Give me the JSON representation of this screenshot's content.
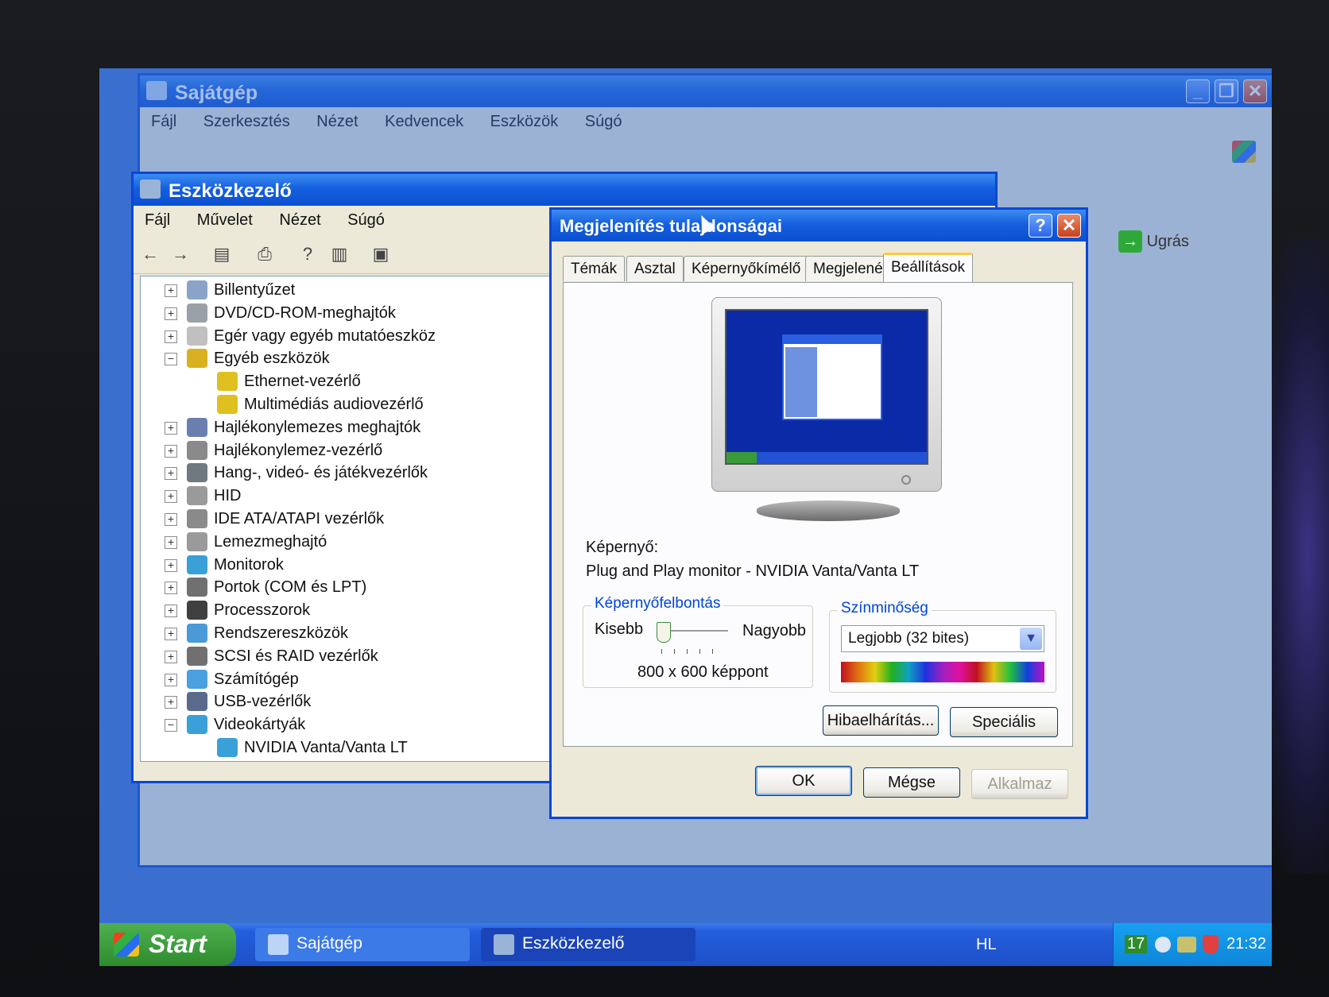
{
  "sajatgep": {
    "title": "Sajátgép",
    "menu": [
      "Fájl",
      "Szerkesztés",
      "Nézet",
      "Kedvencek",
      "Eszközök",
      "Súgó"
    ],
    "go_label": "Ugrás"
  },
  "devmgr": {
    "title": "Eszközkezelő",
    "menu": [
      "Fájl",
      "Művelet",
      "Nézet",
      "Súgó"
    ],
    "tree": [
      {
        "label": "Billentyűzet",
        "state": "+",
        "icon": "keyboard-icon"
      },
      {
        "label": "DVD/CD-ROM-meghajtók",
        "state": "+",
        "icon": "cdrom-icon"
      },
      {
        "label": "Egér vagy egyéb mutatóeszköz",
        "state": "+",
        "icon": "mouse-icon"
      },
      {
        "label": "Egyéb eszközök",
        "state": "-",
        "icon": "unknown-device-icon"
      },
      {
        "label": "Ethernet-vezérlő",
        "state": "child",
        "icon": "warning-device-icon"
      },
      {
        "label": "Multimédiás audiovezérlő",
        "state": "child",
        "icon": "warning-device-icon"
      },
      {
        "label": "Hajlékonylemezes meghajtók",
        "state": "+",
        "icon": "floppy-drive-icon"
      },
      {
        "label": "Hajlékonylemez-vezérlő",
        "state": "+",
        "icon": "floppy-controller-icon"
      },
      {
        "label": "Hang-, videó- és játékvezérlők",
        "state": "+",
        "icon": "sound-icon"
      },
      {
        "label": "HID",
        "state": "+",
        "icon": "hid-icon"
      },
      {
        "label": "IDE ATA/ATAPI vezérlők",
        "state": "+",
        "icon": "ide-icon"
      },
      {
        "label": "Lemezmeghajtó",
        "state": "+",
        "icon": "disk-icon"
      },
      {
        "label": "Monitorok",
        "state": "+",
        "icon": "monitor-icon"
      },
      {
        "label": "Portok (COM és LPT)",
        "state": "+",
        "icon": "port-icon"
      },
      {
        "label": "Processzorok",
        "state": "+",
        "icon": "cpu-icon"
      },
      {
        "label": "Rendszereszközök",
        "state": "+",
        "icon": "system-icon"
      },
      {
        "label": "SCSI és RAID vezérlők",
        "state": "+",
        "icon": "scsi-icon"
      },
      {
        "label": "Számítógép",
        "state": "+",
        "icon": "computer-icon"
      },
      {
        "label": "USB-vezérlők",
        "state": "+",
        "icon": "usb-icon"
      },
      {
        "label": "Videokártyák",
        "state": "-",
        "icon": "display-adapter-icon"
      },
      {
        "label": "NVIDIA Vanta/Vanta LT",
        "state": "child",
        "icon": "display-adapter-icon"
      }
    ]
  },
  "display": {
    "title": "Megjelenítés tulajdonságai",
    "help_btn": "?",
    "close_btn": "✕",
    "tabs": [
      "Témák",
      "Asztal",
      "Képernyőkímélő",
      "Megjelenés",
      "Beállítások"
    ],
    "active_tab": "Beállítások",
    "screen_label": "Képernyő:",
    "monitor_name": "Plug and Play monitor - NVIDIA Vanta/Vanta LT",
    "resolution": {
      "legend": "Képernyőfelbontás",
      "less": "Kisebb",
      "more": "Nagyobb",
      "value": "800 x 600 képpont",
      "slider_level": 0.0
    },
    "color": {
      "legend": "Színminőség",
      "selected": "Legjobb (32 bites)"
    },
    "troubleshoot": "Hibaelhárítás...",
    "advanced": "Speciális",
    "ok": "OK",
    "cancel": "Mégse",
    "apply": "Alkalmaz"
  },
  "taskbar": {
    "start": "Start",
    "tasks": [
      "Sajátgép",
      "Eszközkezelő"
    ],
    "lang": "HL",
    "tray_number": "17",
    "clock": "21:32"
  },
  "colors": {
    "xp_blue": "#0a46d6",
    "dialog_face": "#ece9d8",
    "tab_highlight": "#ffc83c",
    "group_title": "#0046d5"
  }
}
